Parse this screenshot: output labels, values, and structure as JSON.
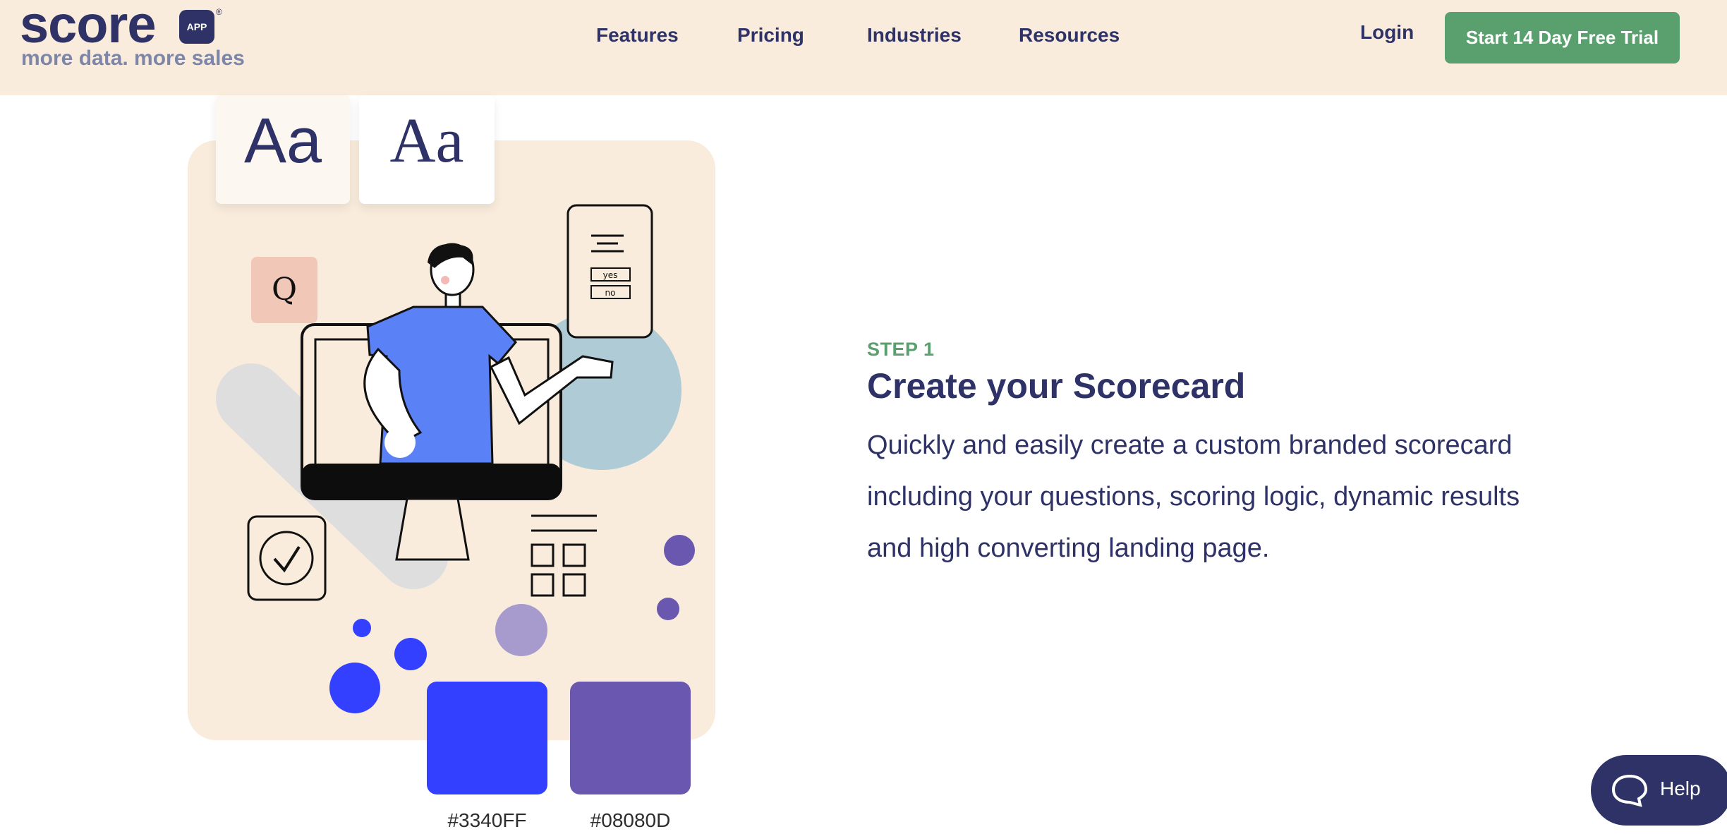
{
  "brand": {
    "logo_word": "scor",
    "logo_word_end": "e",
    "app_badge": "APP",
    "registered": "®",
    "tagline": "more data. more sales"
  },
  "nav": {
    "items": [
      "Features",
      "Pricing",
      "Industries",
      "Resources"
    ],
    "login": "Login",
    "cta": "Start 14 Day Free Trial"
  },
  "illustration": {
    "font_card_sans": "Aa",
    "font_card_serif": "Aa",
    "question_tile": "Q",
    "phone_yes": "yes",
    "phone_no": "no",
    "swatches": [
      {
        "color": "#3340FF",
        "label": "#3340FF"
      },
      {
        "color": "#08080D",
        "label": "#08080D"
      }
    ]
  },
  "content": {
    "step": "STEP 1",
    "title": "Create your Scorecard",
    "description": "Quickly and easily create a custom branded scorecard including your questions, scoring logic, dynamic results and high converting landing page."
  },
  "help": {
    "label": "Help"
  },
  "colors": {
    "navy": "#2e3266",
    "green": "#5aa06f",
    "cream": "#f9ecdc",
    "accent_blue": "#3340ff",
    "accent_purple": "#6a57b0"
  }
}
